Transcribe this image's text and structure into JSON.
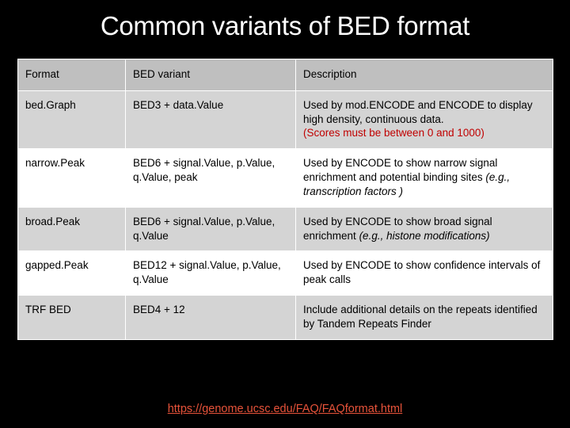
{
  "slide": {
    "title": "Common variants of BED format",
    "footer_link": "https://genome.ucsc.edu/FAQ/FAQformat.html"
  },
  "table": {
    "columns": [
      "Format",
      "BED variant",
      "Description"
    ],
    "rows": [
      {
        "format": "bed.Graph",
        "variant": "BED3 + data.Value",
        "description": "Used by mod.ENCODE and ENCODE to display high density, continuous data.",
        "description_note": "(Scores must be between 0 and 1000)",
        "description_italic": ""
      },
      {
        "format": "narrow.Peak",
        "variant": "BED6 + signal.Value, p.Value, q.Value, peak",
        "description": "Used by ENCODE to show narrow signal enrichment and potential binding sites",
        "description_note": "",
        "description_italic": "(e.g., transcription factors )"
      },
      {
        "format": "broad.Peak",
        "variant": "BED6 + signal.Value, p.Value, q.Value",
        "description": "Used by ENCODE to show broad signal enrichment",
        "description_note": "",
        "description_italic": "(e.g., histone modifications)"
      },
      {
        "format": "gapped.Peak",
        "variant": "BED12 + signal.Value, p.Value, q.Value",
        "description": "Used by ENCODE to show confidence intervals of peak calls",
        "description_note": "",
        "description_italic": ""
      },
      {
        "format": "TRF BED",
        "variant": "BED4 + 12",
        "description": "Include additional details on the repeats identified by Tandem Repeats Finder",
        "description_note": "",
        "description_italic": ""
      }
    ]
  }
}
